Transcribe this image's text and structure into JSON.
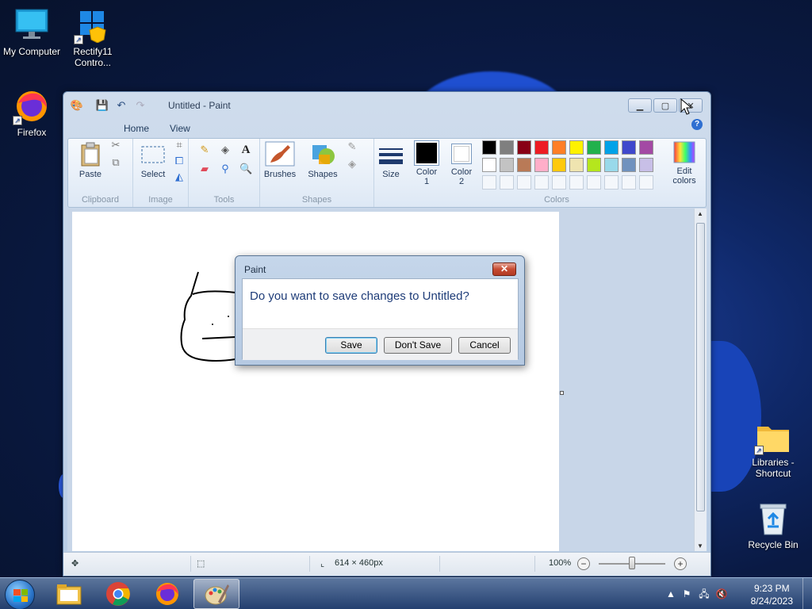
{
  "desktop": {
    "icons": [
      {
        "label": "My Computer"
      },
      {
        "label": "Rectify11 Contro..."
      },
      {
        "label": "Firefox"
      },
      {
        "label": "Libraries - Shortcut"
      },
      {
        "label": "Recycle Bin"
      }
    ]
  },
  "paint": {
    "title": "Untitled - Paint",
    "tabs": [
      "Home",
      "View"
    ],
    "help": "?",
    "ribbon": {
      "clipboard": {
        "paste": "Paste",
        "label": "Clipboard"
      },
      "image": {
        "select": "Select",
        "label": "Image"
      },
      "tools": {
        "label": "Tools",
        "text_tool": "A"
      },
      "shapes": {
        "brushes": "Brushes",
        "shapes": "Shapes",
        "label": "Shapes"
      },
      "size": {
        "label": "Size"
      },
      "colors": {
        "color1_line1": "Color",
        "color1_line2": "1",
        "color2_line1": "Color",
        "color2_line2": "2",
        "edit_line1": "Edit",
        "edit_line2": "colors",
        "label": "Colors",
        "color1": "#000000",
        "color2": "#ffffff",
        "palette_row1": [
          "#000000",
          "#7f7f7f",
          "#880015",
          "#ed1c24",
          "#ff7f27",
          "#fff200",
          "#22b14c",
          "#00a2e8",
          "#3f48cc",
          "#a349a4"
        ],
        "palette_row2": [
          "#ffffff",
          "#c3c3c3",
          "#b97a57",
          "#ffaec9",
          "#ffc90e",
          "#efe4b0",
          "#b5e61d",
          "#99d9ea",
          "#7092be",
          "#c8bfe7"
        ]
      }
    },
    "status": {
      "canvas_size": "614 × 460px",
      "zoom": "100%",
      "zoom_level": 0.5
    }
  },
  "dialog": {
    "title": "Paint",
    "message": "Do you want to save changes to Untitled?",
    "buttons": {
      "save": "Save",
      "dont_save": "Don't Save",
      "cancel": "Cancel"
    }
  },
  "taskbar": {
    "time": "9:23 PM",
    "date": "8/24/2023"
  }
}
